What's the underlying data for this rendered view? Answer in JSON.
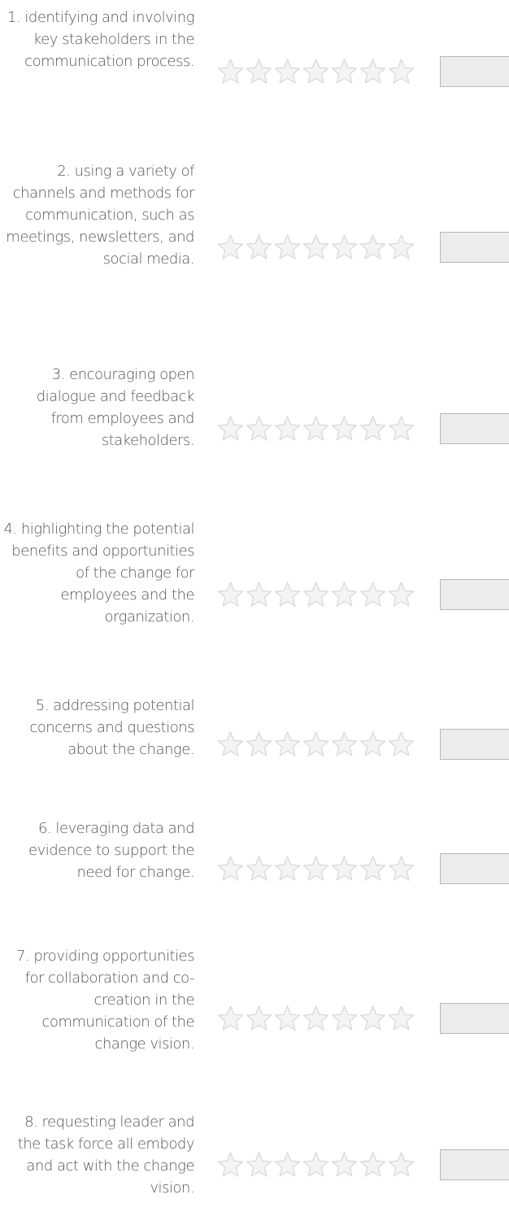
{
  "star_count": 7,
  "colors": {
    "label_text": "#555555",
    "star_fill": "#f4f4f4",
    "star_stroke": "#d9d9d9",
    "input_background": "#ececec",
    "input_border": "#b8b8b8"
  },
  "items": [
    {
      "label": "1. identifying and involving key stakeholders in the communication process.",
      "rating": 0,
      "value": ""
    },
    {
      "label": "2. using a variety of channels and methods for communication, such as meetings, newsletters, and social media.",
      "rating": 0,
      "value": ""
    },
    {
      "label": "3. encouraging open dialogue and feedback from employees and stakeholders.",
      "rating": 0,
      "value": ""
    },
    {
      "label": "4. highlighting the potential benefits and opportunities of the change for employees and the organization.",
      "rating": 0,
      "value": ""
    },
    {
      "label": "5. addressing potential concerns and questions about the change.",
      "rating": 0,
      "value": ""
    },
    {
      "label": "6. leveraging data and evidence to support the need for change.",
      "rating": 0,
      "value": ""
    },
    {
      "label": "7. providing opportunities for collaboration and co-creation in the communication of the change vision.",
      "rating": 0,
      "value": ""
    },
    {
      "label": "8. requesting leader and the task force all embody and act with the change vision.",
      "rating": 0,
      "value": ""
    }
  ]
}
